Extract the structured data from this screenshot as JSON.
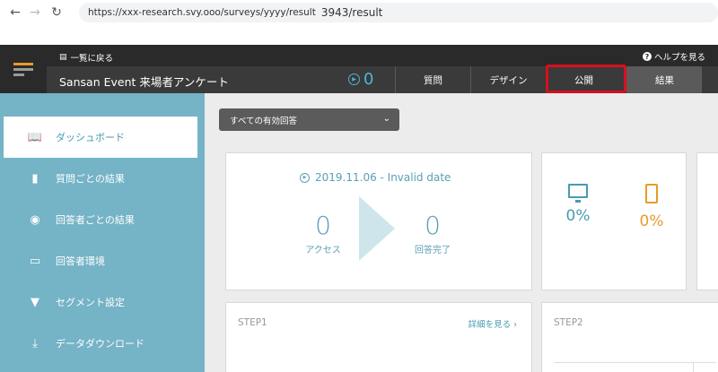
{
  "browser": {
    "url": "https://xxx-research.svy.ooo/surveys/yyyy/result",
    "url_extra": "3943/result"
  },
  "header": {
    "back_label": "一覧に戻る",
    "help_label": "ヘルプを見る",
    "survey_title": "Sansan Event 来場者アンケート",
    "counter": "0",
    "tabs": [
      {
        "label": "質問"
      },
      {
        "label": "デザイン"
      },
      {
        "label": "公開"
      },
      {
        "label": "結果"
      }
    ],
    "highlight_color": "#d80f1e"
  },
  "sidebar": {
    "items": [
      {
        "label": "ダッシュボード",
        "icon": "book-icon"
      },
      {
        "label": "質問ごとの結果",
        "icon": "bar-chart-icon"
      },
      {
        "label": "回答者ごとの結果",
        "icon": "user-circle-icon"
      },
      {
        "label": "回答者環境",
        "icon": "monitor-icon"
      },
      {
        "label": "セグメント設定",
        "icon": "filter-icon"
      },
      {
        "label": "データダウンロード",
        "icon": "download-icon"
      }
    ]
  },
  "main": {
    "filter_label": "すべての有効回答",
    "date": "2019.11.06 - Invalid date",
    "access_value": "0",
    "access_label": "アクセス",
    "complete_value": "0",
    "complete_label": "回答完了",
    "pc_percent": "0%",
    "sp_percent": "0%",
    "step1_title": "STEP1",
    "step1_more": "詳細を見る",
    "step2_title": "STEP2"
  },
  "colors": {
    "sidebar": "#75b3c6",
    "accent": "#4a9ab2",
    "orange": "#e89b2b"
  }
}
